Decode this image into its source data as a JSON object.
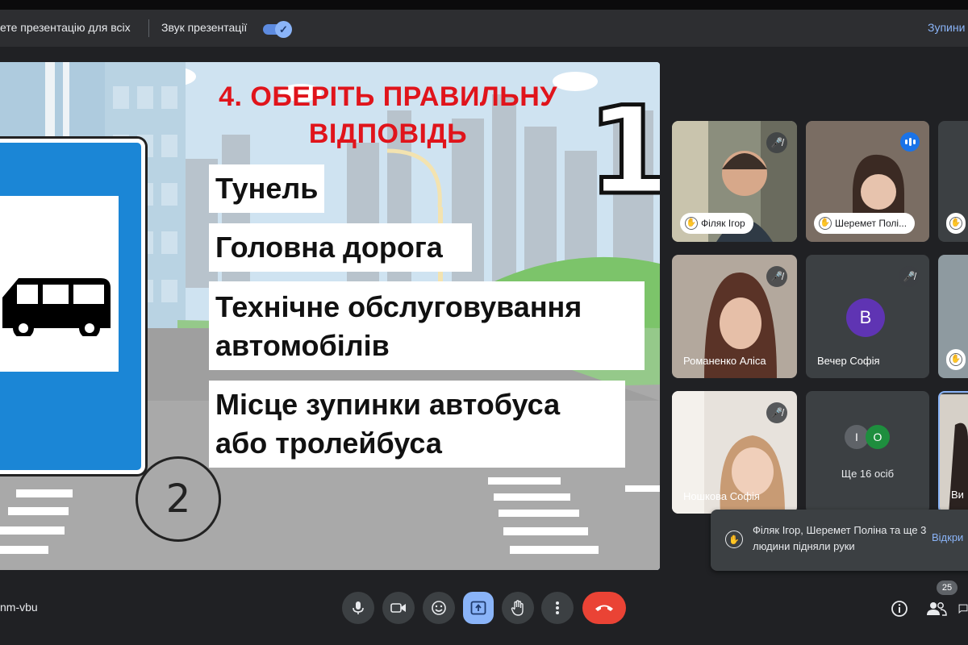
{
  "topbar": {
    "present_label": "ете презентацію для всіх",
    "sound_label": "Звук презентації",
    "sound_enabled": true,
    "stop_label": "Зупини"
  },
  "slide": {
    "title": "4. ОБЕРІТЬ ПРАВИЛЬНУ ВІДПОВІДЬ",
    "number_one": "1",
    "number_two": "2",
    "answers": [
      "Тунель",
      "Головна дорога",
      "Технічне обслуговування автомобілів",
      "Місце зупинки автобуса або тролейбуса"
    ]
  },
  "participants": [
    {
      "name": "Філяк Ігор",
      "hand_raised": true,
      "muted": true
    },
    {
      "name": "Шеремет Полі...",
      "hand_raised": true,
      "speaking": true
    },
    {
      "name": "Романенко Аліса",
      "muted": true
    },
    {
      "name": "Вечер Софія",
      "muted": true,
      "avatar_letter": "В",
      "avatar_color": "#5f34b3"
    },
    {
      "name": "Ношкова Софія",
      "muted": true
    },
    {
      "name": "Ще 16 осіб",
      "avatar_letters": [
        "І",
        "О"
      ],
      "avatar_colors": [
        "#5f6368",
        "#1e8e3e"
      ]
    },
    {
      "name": "Ви"
    }
  ],
  "notification": {
    "text": "Філяк Ігор, Шеремет Поліна та ще 3 людини підняли руки",
    "action": "Відкри"
  },
  "bottombar": {
    "meeting_code": "nm-vbu",
    "participant_count": "25",
    "controls": [
      "mic-icon",
      "camera-icon",
      "emoji-icon",
      "present-icon",
      "raise-hand-icon",
      "more-options-icon",
      "leave-call-icon"
    ],
    "right_controls": [
      "info-icon",
      "people-icon",
      "chat-icon"
    ]
  },
  "colors": {
    "accent": "#8ab4f8",
    "leave": "#ea4335",
    "title_red": "#e0141b",
    "sign_blue": "#1b86d6"
  }
}
